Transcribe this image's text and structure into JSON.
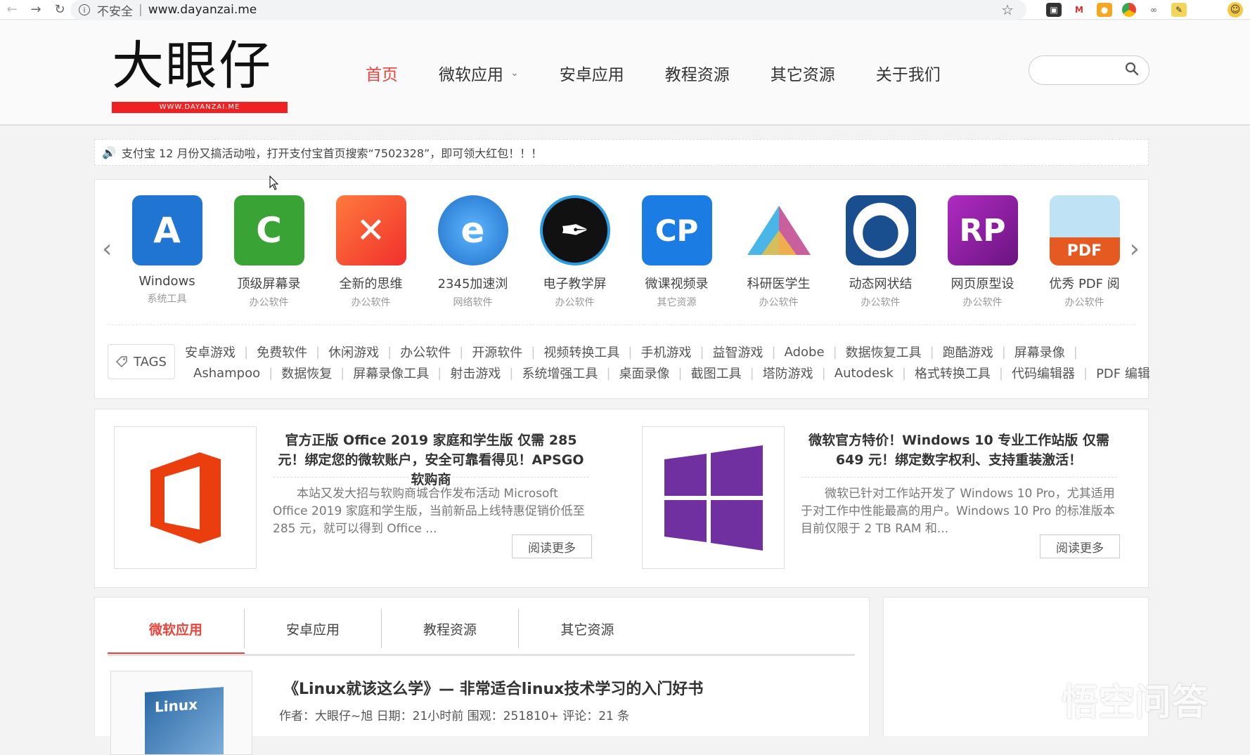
{
  "browser": {
    "insecure_label": "不安全",
    "url": "www.dayanzai.me"
  },
  "logo": {
    "text": "大眼仔",
    "domain": "WWW.DAYANZAI.ME"
  },
  "nav": {
    "items": [
      {
        "label": "首页",
        "active": true
      },
      {
        "label": "微软应用",
        "has_dropdown": true
      },
      {
        "label": "安卓应用"
      },
      {
        "label": "教程资源"
      },
      {
        "label": "其它资源"
      },
      {
        "label": "关于我们"
      }
    ]
  },
  "search": {
    "placeholder": ""
  },
  "notice": {
    "text": "支付宝 12 月份又搞活动啦，打开支付宝首页搜索“7502328”，即可领大红包！！！"
  },
  "apps": [
    {
      "name": "Windows",
      "category": "系统工具",
      "icon": "microsoft-store-icon",
      "color": "#1f75d1"
    },
    {
      "name": "顶级屏幕录",
      "category": "办公软件",
      "icon": "camtasia-icon",
      "color": "#3aa335"
    },
    {
      "name": "全新的思维",
      "category": "办公软件",
      "icon": "xmind-icon",
      "color": "#f0462c"
    },
    {
      "name": "2345加速浏",
      "category": "网络软件",
      "icon": "browser-e-icon",
      "color": "#2f8be0"
    },
    {
      "name": "电子教学屏",
      "category": "办公软件",
      "icon": "pen-nib-icon",
      "color": "#111111"
    },
    {
      "name": "微课视频录",
      "category": "其它资源",
      "icon": "cp-icon",
      "color": "#1b7de3"
    },
    {
      "name": "科研医学生",
      "category": "办公软件",
      "icon": "prism-icon",
      "color": "#e94b8a"
    },
    {
      "name": "动态网状结",
      "category": "办公软件",
      "icon": "network-diagram-icon",
      "color": "#1a4f8f"
    },
    {
      "name": "网页原型设",
      "category": "办公软件",
      "icon": "axure-rp-icon",
      "color": "#8d1fa0"
    },
    {
      "name": "优秀 PDF 阅",
      "category": "办公软件",
      "icon": "pdf-eye-icon",
      "color": "#e55a20"
    }
  ],
  "tags": {
    "label": "TAGS",
    "line1": [
      "安卓游戏",
      "免费软件",
      "休闲游戏",
      "办公软件",
      "开源软件",
      "视频转换工具",
      "手机游戏",
      "益智游戏",
      "Adobe",
      "数据恢复工具",
      "跑酷游戏",
      "屏幕录像"
    ],
    "line2": [
      "Ashampoo",
      "数据恢复",
      "屏幕录像工具",
      "射击游戏",
      "系统增强工具",
      "桌面录像",
      "截图工具",
      "塔防游戏",
      "Autodesk",
      "格式转换工具",
      "代码编辑器",
      "PDF 编辑"
    ]
  },
  "featured": [
    {
      "title": "官方正版 Office 2019 家庭和学生版 仅需 285 元！绑定您的微软账户，安全可靠看得见！APSGO软购商",
      "body": "本站又发大招与软购商城合作发布活动 Microsoft Office 2019 家庭和学生版，当前新品上线特惠促销价低至 285 元，就可以得到 Office ...",
      "read_more": "阅读更多",
      "icon": "office-logo-icon"
    },
    {
      "title": "微软官方特价！Windows 10 专业工作站版 仅需 649 元！绑定数字权利、支持重装激活！",
      "body": "微软已针对工作站开发了 Windows 10 Pro，尤其适用于对工作中性能最高的用户。Windows 10 Pro 的标准版本目前仅限于 2 TB RAM 和...",
      "read_more": "阅读更多",
      "icon": "windows-logo-icon"
    }
  ],
  "tabs": [
    {
      "label": "微软应用",
      "active": true
    },
    {
      "label": "安卓应用"
    },
    {
      "label": "教程资源"
    },
    {
      "label": "其它资源"
    }
  ],
  "post": {
    "title": "《Linux就该这么学》— 非常适合linux技术学习的入门好书",
    "meta": "作者：大眼仔~旭 日期：21小时前 围观：251810+ 评论：21 条",
    "thumb_text": "Linux"
  },
  "watermark": {
    "text": "悟空问答"
  }
}
